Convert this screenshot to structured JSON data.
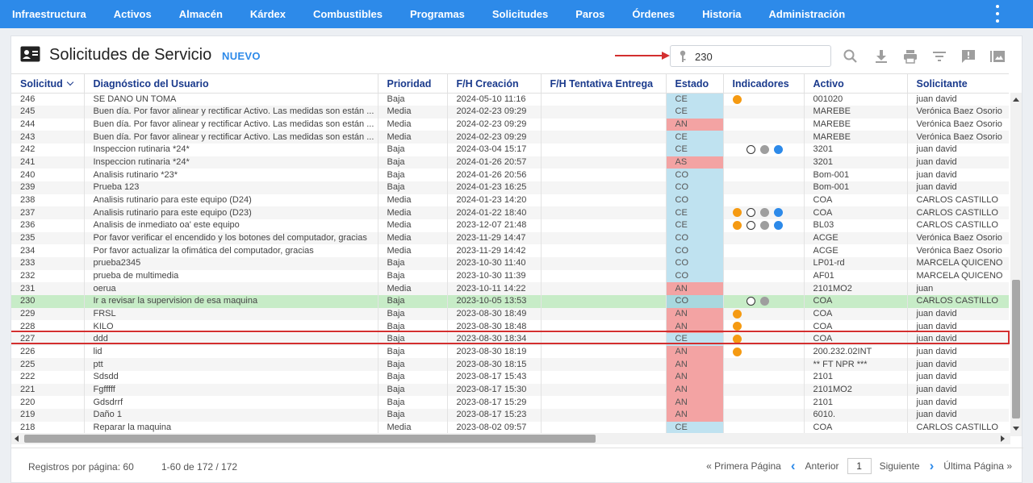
{
  "nav": {
    "items": [
      "Infraestructura",
      "Activos",
      "Almacén",
      "Kárdex",
      "Combustibles",
      "Programas",
      "Solicitudes",
      "Paros",
      "Órdenes",
      "Historia",
      "Administración"
    ],
    "menu_icon": "kebab-vertical-icon"
  },
  "header": {
    "title": "Solicitudes de Servicio",
    "new_label": "NUEVO",
    "search_value": "230",
    "icons": [
      "search-icon",
      "download-icon",
      "print-icon",
      "filter-icon",
      "feedback-icon",
      "gallery-icon"
    ]
  },
  "colors": {
    "primary": "#2d8ae9",
    "status_closed": "#bfe2f0",
    "status_cancelled": "#f3a3a3",
    "selected_row": "#c7ecc7",
    "highlight_border": "#d32f2f",
    "indicator_orange": "#f59a12",
    "indicator_gray": "#9e9e9e",
    "indicator_blue": "#2d8ae9"
  },
  "table": {
    "columns": [
      "Solicitud",
      "Diagnóstico del Usuario",
      "Prioridad",
      "F/H Creación",
      "F/H Tentativa Entrega",
      "Estado",
      "Indicadores",
      "Activo",
      "Solicitante"
    ],
    "rows": [
      {
        "id": "246",
        "diag": "SE DANO UN TOMA",
        "prio": "Baja",
        "created": "2024-05-10 11:16",
        "due": "",
        "status": "CE",
        "ind": [
          "orange"
        ],
        "asset": "001020",
        "req": "juan david"
      },
      {
        "id": "245",
        "diag": "Buen día. Por favor alinear y rectificar Activo. Las medidas son están ...",
        "prio": "Media",
        "created": "2024-02-23 09:29",
        "due": "",
        "status": "CE",
        "ind": [],
        "asset": "MAREBE",
        "req": "Verónica Baez Osorio"
      },
      {
        "id": "244",
        "diag": "Buen día. Por favor alinear y rectificar Activo. Las medidas son están ...",
        "prio": "Media",
        "created": "2024-02-23 09:29",
        "due": "",
        "status": "AN",
        "ind": [],
        "asset": "MAREBE",
        "req": "Verónica Baez Osorio"
      },
      {
        "id": "243",
        "diag": "Buen día. Por favor alinear y rectificar Activo. Las medidas son están ...",
        "prio": "Media",
        "created": "2024-02-23 09:29",
        "due": "",
        "status": "CE",
        "ind": [],
        "asset": "MAREBE",
        "req": "Verónica Baez Osorio"
      },
      {
        "id": "242",
        "diag": "Inspeccion rutinaria *24*",
        "prio": "Baja",
        "created": "2024-03-04 15:17",
        "due": "",
        "status": "CE",
        "ind": [
          "none",
          "empty",
          "gray",
          "blue"
        ],
        "asset": "3201",
        "req": "juan david"
      },
      {
        "id": "241",
        "diag": "Inspeccion rutinaria *24*",
        "prio": "Baja",
        "created": "2024-01-26 20:57",
        "due": "",
        "status": "AS",
        "ind": [],
        "asset": "3201",
        "req": "juan david"
      },
      {
        "id": "240",
        "diag": "Analisis rutinario *23*",
        "prio": "Baja",
        "created": "2024-01-26 20:56",
        "due": "",
        "status": "CO",
        "ind": [],
        "asset": "Bom-001",
        "req": "juan david"
      },
      {
        "id": "239",
        "diag": "Prueba 123",
        "prio": "Baja",
        "created": "2024-01-23 16:25",
        "due": "",
        "status": "CO",
        "ind": [],
        "asset": "Bom-001",
        "req": "juan david"
      },
      {
        "id": "238",
        "diag": "Analisis rutinario para este equipo (D24)",
        "prio": "Media",
        "created": "2024-01-23 14:20",
        "due": "",
        "status": "CO",
        "ind": [],
        "asset": "COA",
        "req": "CARLOS CASTILLO"
      },
      {
        "id": "237",
        "diag": "Analisis rutinario para este equipo (D23)",
        "prio": "Media",
        "created": "2024-01-22 18:40",
        "due": "",
        "status": "CE",
        "ind": [
          "orange",
          "empty",
          "gray",
          "blue"
        ],
        "asset": "COA",
        "req": "CARLOS CASTILLO"
      },
      {
        "id": "236",
        "diag": "Analisis de inmediato oa' este equipo",
        "prio": "Media",
        "created": "2023-12-07 21:48",
        "due": "",
        "status": "CE",
        "ind": [
          "orange",
          "empty",
          "gray",
          "blue"
        ],
        "asset": "BL03",
        "req": "CARLOS CASTILLO"
      },
      {
        "id": "235",
        "diag": "Por favor verificar el encendido y los botones del computador, gracias",
        "prio": "Media",
        "created": "2023-11-29 14:47",
        "due": "",
        "status": "CO",
        "ind": [],
        "asset": "ACGE",
        "req": "Verónica Baez Osorio"
      },
      {
        "id": "234",
        "diag": "Por favor actualizar la ofimática del computador, gracias",
        "prio": "Media",
        "created": "2023-11-29 14:42",
        "due": "",
        "status": "CO",
        "ind": [],
        "asset": "ACGE",
        "req": "Verónica Baez Osorio"
      },
      {
        "id": "233",
        "diag": "prueba2345",
        "prio": "Baja",
        "created": "2023-10-30 11:40",
        "due": "",
        "status": "CO",
        "ind": [],
        "asset": "LP01-rd",
        "req": "MARCELA QUICENO"
      },
      {
        "id": "232",
        "diag": "prueba de multimedia",
        "prio": "Baja",
        "created": "2023-10-30 11:39",
        "due": "",
        "status": "CO",
        "ind": [],
        "asset": "AF01",
        "req": "MARCELA QUICENO"
      },
      {
        "id": "231",
        "diag": "oerua",
        "prio": "Media",
        "created": "2023-10-11 14:22",
        "due": "",
        "status": "AN",
        "ind": [],
        "asset": "2101MO2",
        "req": "juan"
      },
      {
        "id": "230",
        "diag": "Ir a revisar la supervision de esa maquina",
        "prio": "Baja",
        "created": "2023-10-05 13:53",
        "due": "",
        "status": "CO",
        "ind": [
          "none",
          "empty",
          "gray"
        ],
        "asset": "COA",
        "req": "CARLOS CASTILLO",
        "selected": true
      },
      {
        "id": "229",
        "diag": "FRSL",
        "prio": "Baja",
        "created": "2023-08-30 18:49",
        "due": "",
        "status": "AN",
        "ind": [
          "orange"
        ],
        "asset": "COA",
        "req": "juan david"
      },
      {
        "id": "228",
        "diag": "KILO",
        "prio": "Baja",
        "created": "2023-08-30 18:48",
        "due": "",
        "status": "AN",
        "ind": [
          "orange"
        ],
        "asset": "COA",
        "req": "juan david"
      },
      {
        "id": "227",
        "diag": "ddd",
        "prio": "Baja",
        "created": "2023-08-30 18:34",
        "due": "",
        "status": "CE",
        "ind": [
          "orange"
        ],
        "asset": "COA",
        "req": "juan david"
      },
      {
        "id": "226",
        "diag": "lid",
        "prio": "Baja",
        "created": "2023-08-30 18:19",
        "due": "",
        "status": "AN",
        "ind": [
          "orange"
        ],
        "asset": "200.232.02INT",
        "req": "juan david"
      },
      {
        "id": "225",
        "diag": "ptt",
        "prio": "Baja",
        "created": "2023-08-30 18:15",
        "due": "",
        "status": "AN",
        "ind": [],
        "asset": "** FT NPR ***",
        "req": "juan david"
      },
      {
        "id": "222",
        "diag": "Sdsdd",
        "prio": "Baja",
        "created": "2023-08-17 15:43",
        "due": "",
        "status": "AN",
        "ind": [],
        "asset": "2101",
        "req": "juan david"
      },
      {
        "id": "221",
        "diag": "Fgfffff",
        "prio": "Baja",
        "created": "2023-08-17 15:30",
        "due": "",
        "status": "AN",
        "ind": [],
        "asset": "2101MO2",
        "req": "juan david"
      },
      {
        "id": "220",
        "diag": "Gdsdrrf",
        "prio": "Baja",
        "created": "2023-08-17 15:29",
        "due": "",
        "status": "AN",
        "ind": [],
        "asset": "2101",
        "req": "juan david"
      },
      {
        "id": "219",
        "diag": "Daño 1",
        "prio": "Baja",
        "created": "2023-08-17 15:23",
        "due": "",
        "status": "AN",
        "ind": [],
        "asset": "6010.",
        "req": "juan david"
      },
      {
        "id": "218",
        "diag": "Reparar la maquina",
        "prio": "Media",
        "created": "2023-08-02 09:57",
        "due": "",
        "status": "CE",
        "ind": [],
        "asset": "COA",
        "req": "CARLOS CASTILLO"
      }
    ]
  },
  "footer": {
    "rows_per_page": "Registros por página: 60",
    "range": "1-60 de 172 / 172",
    "first": "« Primera Página",
    "prev": "Anterior",
    "page": "1",
    "next": "Siguiente",
    "last": "Última Página »"
  }
}
